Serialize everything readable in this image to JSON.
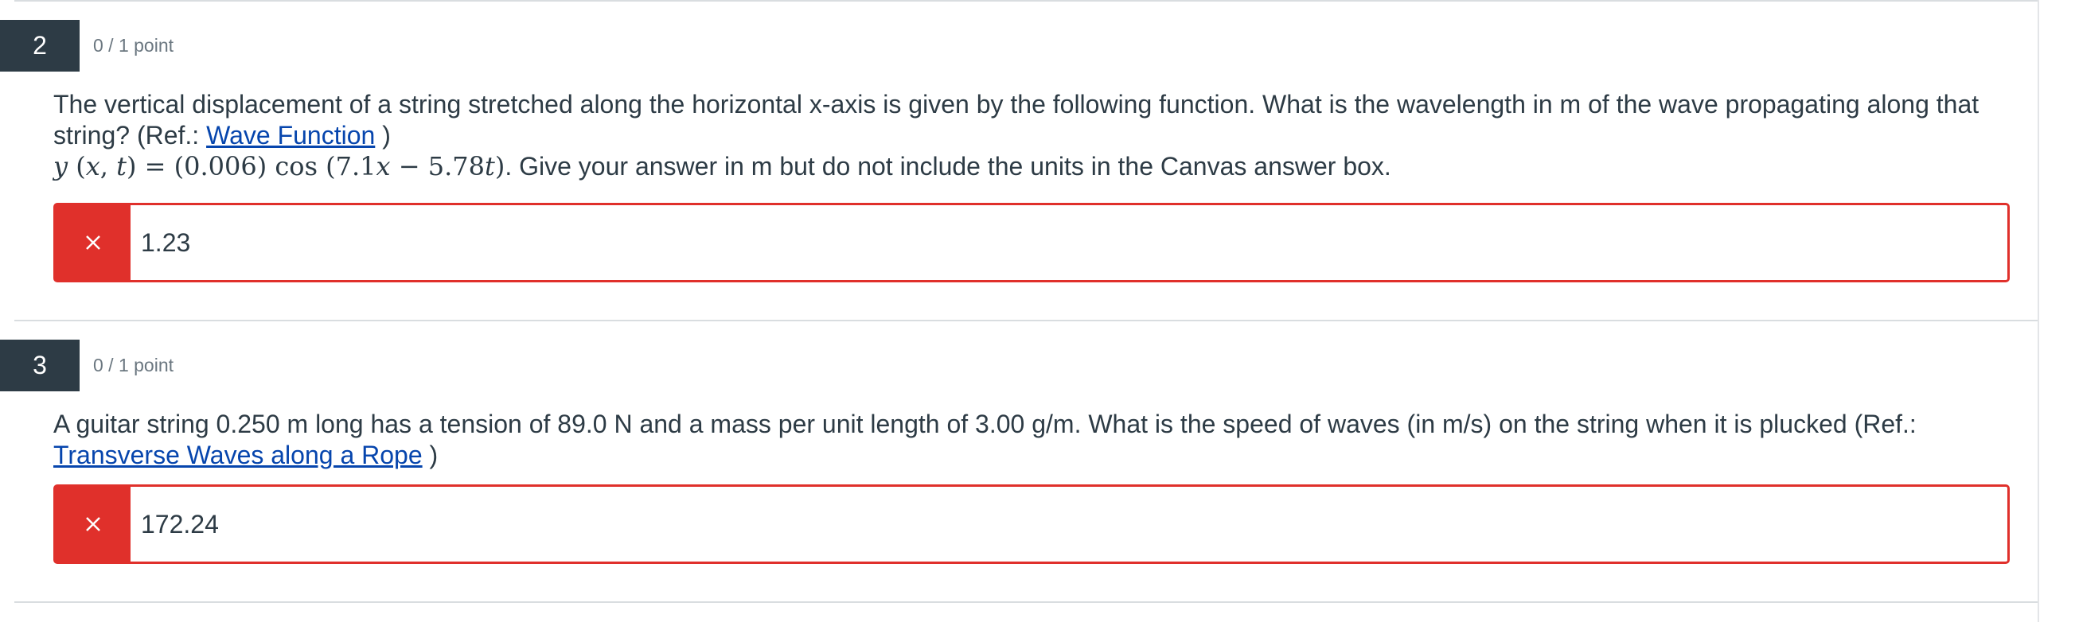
{
  "questions": [
    {
      "number": "2",
      "points": "0 / 1 point",
      "text_before_link": "The vertical displacement of a string stretched along the horizontal x-axis is given by the following function. What is the wavelength in m of the wave propagating along that string?  (Ref.: ",
      "link": "Wave Function",
      "text_after_link": " )",
      "formula": "y (x, t) = (0.006) cos (7.1x − 5.78t)",
      "formula_suffix": ". Give your answer in m but do not include the units in the Canvas answer box.",
      "answer": "1.23",
      "status": "incorrect"
    },
    {
      "number": "3",
      "points": "0 / 1 point",
      "text_before_link": "A guitar string 0.250 m long has a tension of 89.0 N and a mass per unit length of 3.00 g/m. What is the speed of waves (in m/s) on the string when it is plucked (Ref.: ",
      "link": "Transverse Waves along a Rope",
      "text_after_link": " )",
      "answer": "172.24",
      "status": "incorrect"
    }
  ],
  "colors": {
    "number_badge": "#2d3b45",
    "incorrect": "#e0302b",
    "link": "#0645ad",
    "points_text": "#6b7780"
  },
  "icons": {
    "incorrect": "close-icon"
  }
}
